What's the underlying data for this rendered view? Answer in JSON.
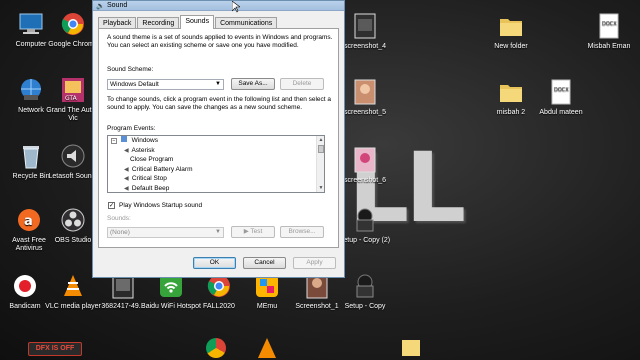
{
  "desktop": {
    "icons": [
      {
        "label": "Computer",
        "icon": "computer-icon"
      },
      {
        "label": "Google Chrome",
        "icon": "chrome-icon"
      },
      {
        "label": "Network",
        "icon": "network-icon"
      },
      {
        "label": "Grand The Auto - Vic",
        "icon": "game-icon"
      },
      {
        "label": "Recycle Bin",
        "icon": "recycle-bin-icon"
      },
      {
        "label": "Letasoft Soun...",
        "icon": "speaker-app-icon"
      },
      {
        "label": "Avast Free Antivirus",
        "icon": "avast-icon"
      },
      {
        "label": "OBS Studio",
        "icon": "obs-icon"
      },
      {
        "label": "Bandicam",
        "icon": "bandicam-icon"
      },
      {
        "label": "VLC media player",
        "icon": "vlc-icon"
      },
      {
        "label": "3682417-49...",
        "icon": "image-file-icon"
      },
      {
        "label": "Baidu WiFi Hotspot",
        "icon": "wifi-hotspot-icon"
      },
      {
        "label": "FALL2020",
        "icon": "chrome-shortcut-icon"
      },
      {
        "label": "MEmu",
        "icon": "memu-icon"
      },
      {
        "label": "Screenshot_1",
        "icon": "image-file-icon"
      },
      {
        "label": "Setup - Copy",
        "icon": "setup-icon"
      },
      {
        "label": "setup - Copy (2)",
        "icon": "setup-icon"
      },
      {
        "label": "screenshot_4",
        "icon": "image-file-icon"
      },
      {
        "label": "screenshot_5",
        "icon": "image-file-icon"
      },
      {
        "label": "screenshot_6",
        "icon": "image-file-icon"
      },
      {
        "label": "New folder",
        "icon": "folder-icon"
      },
      {
        "label": "misbah 2",
        "icon": "folder-icon"
      },
      {
        "label": "Misbah Eman",
        "icon": "docx-icon"
      },
      {
        "label": "Abdul mateen",
        "icon": "docx-icon"
      }
    ],
    "background_text": "L L",
    "bottom_badge": "DFX IS OFF"
  },
  "dialog": {
    "title": "Sound",
    "tabs": [
      "Playback",
      "Recording",
      "Sounds",
      "Communications"
    ],
    "active_tab": "Sounds",
    "intro": "A sound theme is a set of sounds applied to events in Windows and programs.  You can select an existing scheme or save one you have modified.",
    "scheme_label": "Sound Scheme:",
    "scheme_value": "Windows Default",
    "save_as": "Save As...",
    "delete": "Delete",
    "instructions": "To change sounds, click a program event in the following list and then select a sound to apply.  You can save the changes as a new sound scheme.",
    "events_label": "Program Events:",
    "events": [
      {
        "label": "Windows",
        "group": true
      },
      {
        "label": "Asterisk",
        "sound": true
      },
      {
        "label": "Close Program",
        "sound": false
      },
      {
        "label": "Critical Battery Alarm",
        "sound": true
      },
      {
        "label": "Critical Stop",
        "sound": true
      },
      {
        "label": "Default Beep",
        "sound": true
      }
    ],
    "startup_label": "Play Windows Startup sound",
    "startup_checked": "✓",
    "sounds_label": "Sounds:",
    "sounds_value": "(None)",
    "test": "Test",
    "browse": "Browse...",
    "ok": "OK",
    "cancel": "Cancel",
    "apply": "Apply",
    "accent": "#3c7fb1"
  }
}
